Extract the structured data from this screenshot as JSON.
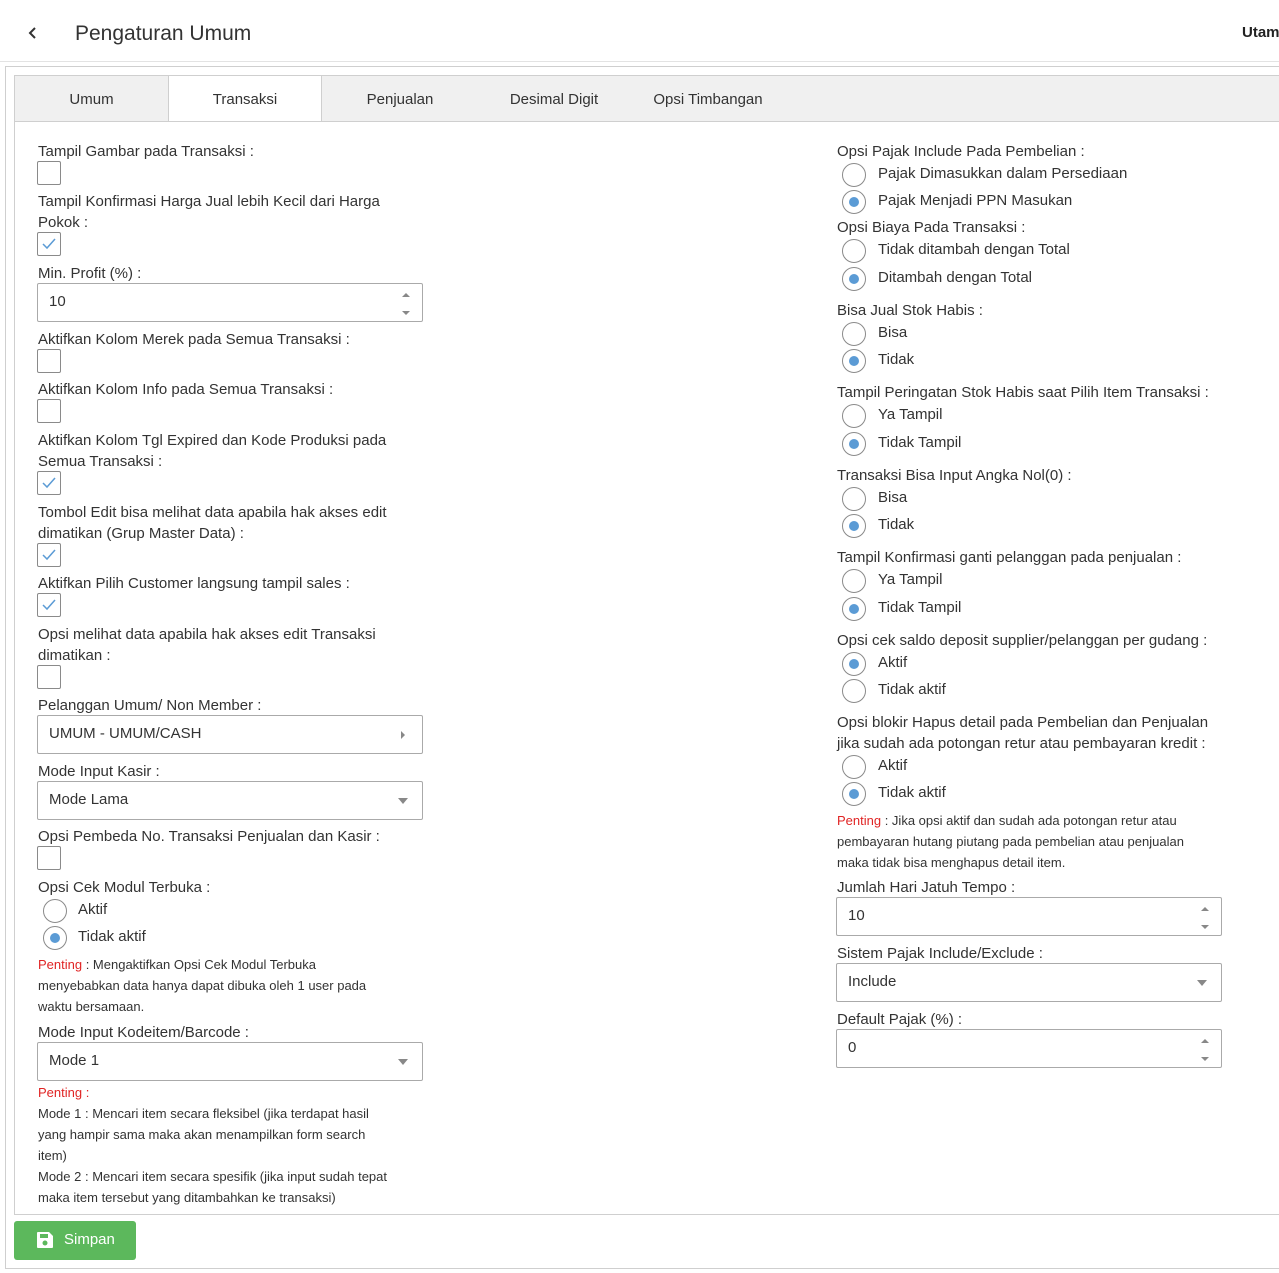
{
  "header": {
    "title": "Pengaturan Umum",
    "right_label": "Utam"
  },
  "tabs": [
    "Umum",
    "Transaksi",
    "Penjualan",
    "Desimal Digit",
    "Opsi Timbangan"
  ],
  "left": {
    "tampil_gambar": "Tampil Gambar pada Transaksi :",
    "konfirmasi_harga_1": "Tampil Konfirmasi Harga Jual lebih Kecil dari Harga",
    "konfirmasi_harga_2": "Pokok :",
    "min_profit": "Min. Profit (%) :",
    "min_profit_value": "10",
    "kolom_merek": "Aktifkan Kolom Merek pada Semua Transaksi :",
    "kolom_info": "Aktifkan Kolom Info pada Semua Transaksi :",
    "kolom_tgl_1": "Aktifkan Kolom Tgl Expired dan Kode Produksi pada",
    "kolom_tgl_2": "Semua Transaksi :",
    "tombol_edit_1": "Tombol Edit bisa melihat data apabila hak akses edit",
    "tombol_edit_2": "dimatikan (Grup Master Data) :",
    "pilih_customer": "Aktifkan Pilih Customer langsung tampil sales :",
    "opsi_melihat_1": "Opsi melihat data apabila hak akses edit Transaksi",
    "opsi_melihat_2": "dimatikan :",
    "pelanggan_umum": "Pelanggan Umum/ Non Member :",
    "pelanggan_value": "UMUM - UMUM/CASH",
    "mode_input_kasir": "Mode Input Kasir :",
    "mode_kasir_value": "Mode Lama",
    "opsi_pembeda": "Opsi Pembeda No. Transaksi Penjualan dan Kasir :",
    "opsi_cek_modul": "Opsi Cek Modul Terbuka :",
    "aktif": "Aktif",
    "tidak_aktif": "Tidak aktif",
    "penting": "Penting",
    "note_cek_1": " : Mengaktifkan Opsi Cek Modul Terbuka",
    "note_cek_2": "menyebabkan data hanya dapat dibuka oleh 1 user pada",
    "note_cek_3": "waktu bersamaan.",
    "mode_kodeitem": "Mode Input Kodeitem/Barcode :",
    "mode_kodeitem_value": "Mode 1",
    "penting_colon": "Penting :",
    "mode_note_1": "Mode 1 : Mencari item secara fleksibel (jika terdapat hasil",
    "mode_note_2": "yang hampir sama maka akan menampilkan form search",
    "mode_note_3": "item)",
    "mode_note_4": "Mode 2 : Mencari item secara spesifik (jika input sudah tepat",
    "mode_note_5": "maka item tersebut yang ditambahkan ke transaksi)"
  },
  "right": {
    "pajak_include": "Opsi Pajak Include Pada Pembelian :",
    "pajak_opt1": "Pajak Dimasukkan dalam Persediaan",
    "pajak_opt2": "Pajak Menjadi PPN Masukan",
    "biaya": "Opsi Biaya Pada Transaksi :",
    "biaya_opt1": "Tidak ditambah dengan Total",
    "biaya_opt2": "Ditambah dengan Total",
    "stok_habis": "Bisa Jual Stok Habis :",
    "bisa": "Bisa",
    "tidak": "Tidak",
    "peringatan": "Tampil Peringatan Stok Habis saat Pilih Item Transaksi :",
    "ya_tampil": "Ya Tampil",
    "tidak_tampil": "Tidak Tampil",
    "angka_nol": "Transaksi Bisa Input Angka Nol(0) :",
    "konfirmasi_pelanggan": "Tampil Konfirmasi ganti pelanggan pada penjualan :",
    "cek_saldo": "Opsi cek saldo deposit supplier/pelanggan per gudang :",
    "aktif": "Aktif",
    "tidak_aktif": "Tidak aktif",
    "blokir_1": "Opsi blokir Hapus detail pada Pembelian dan Penjualan",
    "blokir_2": "jika sudah ada potongan retur atau pembayaran kredit :",
    "penting": "Penting",
    "blokir_note_1": " : Jika opsi aktif dan sudah ada potongan retur atau",
    "blokir_note_2": "pembayaran hutang piutang pada pembelian atau penjualan",
    "blokir_note_3": "maka tidak bisa menghapus detail item.",
    "jatuh_tempo": "Jumlah Hari Jatuh Tempo :",
    "jatuh_tempo_value": "10",
    "sistem_pajak": "Sistem Pajak Include/Exclude :",
    "sistem_pajak_value": "Include",
    "default_pajak": "Default Pajak (%) :",
    "default_pajak_value": "0"
  },
  "save_label": "Simpan",
  "colors": {
    "accent": "#5b9bd5",
    "save": "#5cb85c",
    "penting": "#e02424"
  }
}
